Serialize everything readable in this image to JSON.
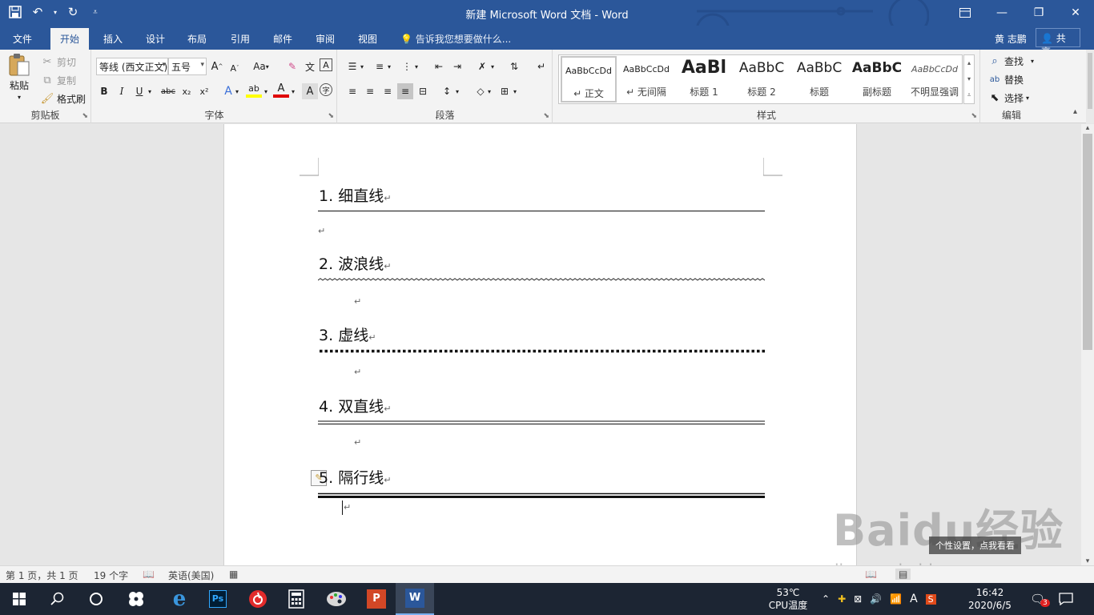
{
  "window": {
    "title": "新建 Microsoft Word 文档 - Word",
    "ribbon_display_icon": "ribbon-display-options-icon",
    "minimize": "—",
    "restore": "❐",
    "close": "✕"
  },
  "qat": {
    "save_icon": "save-icon",
    "undo_icon": "undo-icon",
    "redo_icon": "redo-icon",
    "customize_icon": "customize-qat-icon"
  },
  "tabs": [
    {
      "label": "文件",
      "active": false
    },
    {
      "label": "开始",
      "active": true
    },
    {
      "label": "插入",
      "active": false
    },
    {
      "label": "设计",
      "active": false
    },
    {
      "label": "布局",
      "active": false
    },
    {
      "label": "引用",
      "active": false
    },
    {
      "label": "邮件",
      "active": false
    },
    {
      "label": "审阅",
      "active": false
    },
    {
      "label": "视图",
      "active": false
    }
  ],
  "tellme": "告诉我您想要做什么...",
  "user": "黄 志鹏",
  "share": "共享",
  "ribbon": {
    "clipboard": {
      "paste": "粘贴",
      "cut": "剪切",
      "copy": "复制",
      "format_painter": "格式刷",
      "label": "剪贴板"
    },
    "font": {
      "font_name": "等线 (西文正文)",
      "font_size": "五号",
      "label": "字体",
      "grow": "A",
      "shrink": "A",
      "case": "Aa",
      "bold": "B",
      "italic": "I",
      "underline": "U",
      "strike": "abc",
      "sub": "x₂",
      "sup": "x²",
      "font_color": "A",
      "highlight": "ab"
    },
    "paragraph": {
      "label": "段落"
    },
    "styles": {
      "label": "样式",
      "items": [
        {
          "preview": "AaBbCcDd",
          "name": "↵ 正文"
        },
        {
          "preview": "AaBbCcDd",
          "name": "↵ 无间隔"
        },
        {
          "preview": "AaBl",
          "name": "标题 1"
        },
        {
          "preview": "AaBbC",
          "name": "标题 2"
        },
        {
          "preview": "AaBbC",
          "name": "标题"
        },
        {
          "preview": "AaBbC",
          "name": "副标题"
        },
        {
          "preview": "AaBbCcDd",
          "name": "不明显强调"
        }
      ]
    },
    "editing": {
      "find": "查找",
      "replace": "替换",
      "select": "选择",
      "label": "编辑"
    }
  },
  "document": {
    "headings": [
      {
        "num": "1.",
        "text": "细直线",
        "line": "single"
      },
      {
        "num": "2.",
        "text": "波浪线",
        "line": "wavy"
      },
      {
        "num": "3.",
        "text": "虚线",
        "line": "dotted"
      },
      {
        "num": "4.",
        "text": "双直线",
        "line": "double"
      },
      {
        "num": "5.",
        "text": "隔行线",
        "line": "thick-thin"
      }
    ],
    "para_mark": "↵"
  },
  "status": {
    "page": "第 1 页，共 1 页",
    "words": "19 个字",
    "language": "英语(美国)",
    "proofing_icon": "proofing-icon",
    "macro_icon": "macro-record-icon"
  },
  "watermark": {
    "text": "Baidu经验",
    "url": "jingyan.baidu.com",
    "tooltip": "个性设置，点我看看"
  },
  "taskbar": {
    "temp": "53℃",
    "temp_label": "CPU温度",
    "time": "16:42",
    "date": "2020/6/5",
    "ime": "A",
    "notif_count": "3",
    "apps": [
      "start-icon",
      "search-icon",
      "cortana-icon",
      "pinwheel-app-icon",
      "edge-icon",
      "photoshop-icon",
      "netease-music-icon",
      "calculator-icon",
      "paint-app-icon",
      "powerpoint-icon",
      "word-icon"
    ],
    "ps_label": "Ps"
  },
  "colors": {
    "word_blue": "#2b579a",
    "taskbar": "#1c2533"
  }
}
